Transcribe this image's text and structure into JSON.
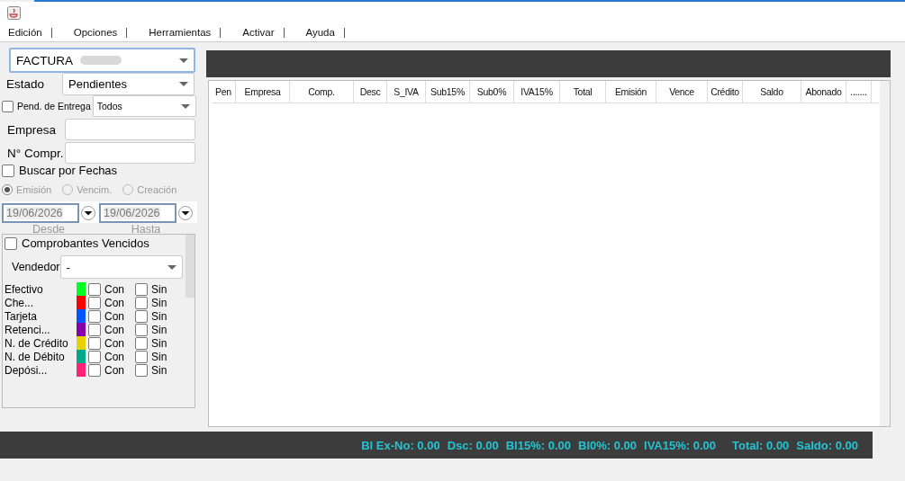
{
  "menu": [
    {
      "label": "Edición"
    },
    {
      "label": "Opciones"
    },
    {
      "label": "Herramientas"
    },
    {
      "label": "Activar"
    },
    {
      "label": "Ayuda"
    }
  ],
  "document_type": {
    "value": "FACTURA"
  },
  "estado": {
    "label": "Estado",
    "value": "Pendientes"
  },
  "pend_entrega": {
    "label": "Pend. de Entrega",
    "checked": false,
    "value": "Todos"
  },
  "fields": [
    {
      "label": "Empresa"
    },
    {
      "label": "N° Compr."
    }
  ],
  "buscar_fechas": {
    "label": "Buscar por Fechas",
    "checked": false
  },
  "date_types": [
    {
      "label": "Emisión",
      "selected": true
    },
    {
      "label": "Vencim.",
      "selected": false
    },
    {
      "label": "Creación",
      "selected": false
    }
  ],
  "dates": [
    {
      "value": "19/06/2026",
      "caption": "Desde"
    },
    {
      "value": "19/06/2026",
      "caption": "Hasta"
    }
  ],
  "vencidos": {
    "label": "Comprobantes Vencidos",
    "checked": false
  },
  "vendedor": {
    "label": "Vendedor",
    "value": "-"
  },
  "payments": [
    {
      "name": "Efectivo",
      "color": "#00ff21",
      "con": {
        "label": "Con",
        "checked": false
      },
      "sin": {
        "label": "Sin",
        "checked": false
      }
    },
    {
      "name": "Che...",
      "color": "#ff0000",
      "con": {
        "label": "Con",
        "checked": false
      },
      "sin": {
        "label": "Sin",
        "checked": false
      }
    },
    {
      "name": "Tarjeta",
      "color": "#0055ff",
      "con": {
        "label": "Con",
        "checked": false
      },
      "sin": {
        "label": "Sin",
        "checked": false
      }
    },
    {
      "name": "Retenci...",
      "color": "#8800aa",
      "con": {
        "label": "Con",
        "checked": false
      },
      "sin": {
        "label": "Sin",
        "checked": false
      }
    },
    {
      "name": "N. de Crédito",
      "color": "#e6d200",
      "con": {
        "label": "Con",
        "checked": false
      },
      "sin": {
        "label": "Sin",
        "checked": false
      }
    },
    {
      "name": "N. de Débito",
      "color": "#00aa88",
      "con": {
        "label": "Con",
        "checked": false
      },
      "sin": {
        "label": "Sin",
        "checked": false
      }
    },
    {
      "name": "Depósi...",
      "color": "#ff2277",
      "con": {
        "label": "Con",
        "checked": false
      },
      "sin": {
        "label": "Sin",
        "checked": false
      }
    }
  ],
  "table": {
    "columns": [
      "Pen",
      "Empresa",
      "Comp.",
      "Desc",
      "S_IVA",
      "Sub15%",
      "Sub0%",
      "IVA15%",
      "Total",
      "Emisión",
      "Vence",
      "Crédito",
      "Saldo",
      "Abonado",
      "......."
    ]
  },
  "status_bar": [
    "Bl Ex-No: 0.00",
    "Dsc: 0.00",
    "Bl15%: 0.00",
    "Bl0%: 0.00",
    "IVA15%: 0.00",
    "Total: 0.00",
    "Saldo: 0.00"
  ]
}
